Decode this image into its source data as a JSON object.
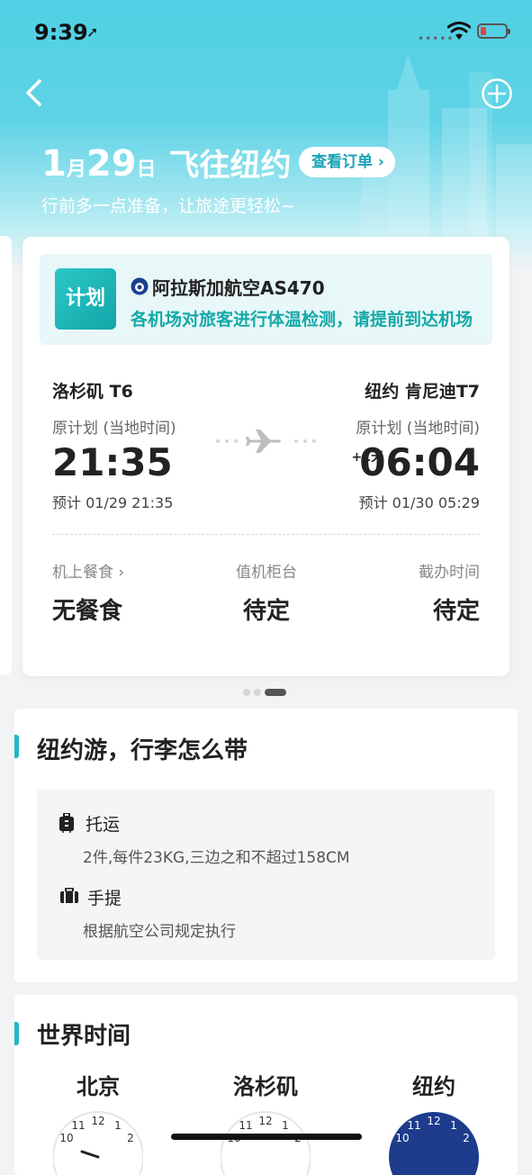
{
  "status_bar": {
    "time": "9:39",
    "signal": "•••••"
  },
  "header": {
    "date_month": "1",
    "month_unit": "月",
    "date_day": "29",
    "day_unit": "日",
    "destination": "飞往纽约",
    "order_button": "查看订单 ›",
    "subtitle": "行前多一点准备，让旅途更轻松~"
  },
  "flight_card": {
    "status_badge": "计划",
    "airline": "阿拉斯加航空AS470",
    "notice": "各机场对旅客进行体温检测，请提前到达机场",
    "departure": {
      "airport": "洛杉矶 T6",
      "time_label": "原计划 (当地时间)",
      "time": "21:35",
      "estimated": "预计 01/29 21:35"
    },
    "arrival": {
      "airport": "纽约 肯尼迪T7",
      "time_label": "原计划 (当地时间)",
      "day_offset": "+1天",
      "time": "06:04",
      "estimated": "预计 01/30 05:29"
    },
    "info": [
      {
        "label": "机上餐食 ›",
        "value": "无餐食"
      },
      {
        "label": "值机柜台",
        "value": "待定"
      },
      {
        "label": "截办时间",
        "value": "待定"
      }
    ],
    "pager": {
      "count": 3,
      "active": 3
    }
  },
  "luggage": {
    "title": "纽约游，行李怎么带",
    "checked": {
      "title": "托运",
      "desc": "2件,每件23KG,三边之和不超过158CM"
    },
    "carry_on": {
      "title": "手提",
      "desc": "根据航空公司规定执行"
    }
  },
  "world_time": {
    "title": "世界时间",
    "cities": [
      "北京",
      "洛杉矶",
      "纽约"
    ]
  },
  "colors": {
    "accent": "#23b6c8",
    "brand_teal": "#15a9a8",
    "header_cyan": "#4fd0e4"
  }
}
